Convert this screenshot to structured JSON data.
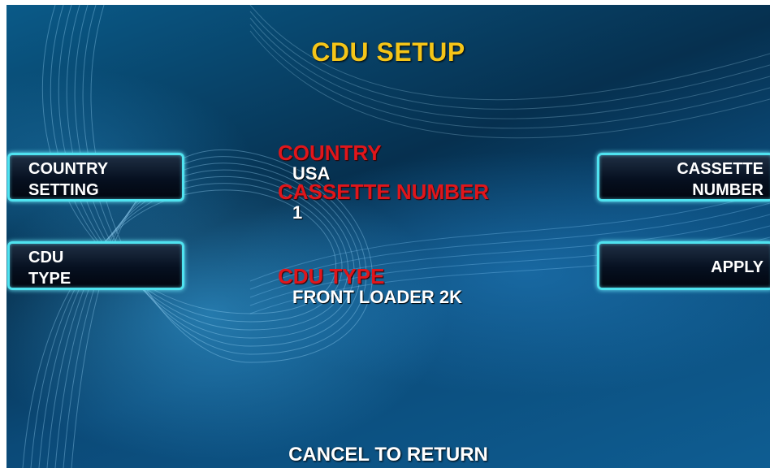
{
  "screen": {
    "title": "CDU SETUP",
    "footer": "CANCEL TO RETURN"
  },
  "left_buttons": [
    {
      "line1": "COUNTRY",
      "line2": "SETTING"
    },
    {
      "line1": "CDU",
      "line2": "TYPE"
    }
  ],
  "right_buttons": [
    {
      "line1": "CASSETTE",
      "line2": "NUMBER"
    },
    {
      "line1": "APPLY",
      "line2": ""
    }
  ],
  "info": {
    "country_label": "COUNTRY",
    "country_value": "USA",
    "cassette_label": "CASSETTE NUMBER",
    "cassette_value": "1",
    "cdu_type_label": "CDU TYPE",
    "cdu_type_value": "FRONT LOADER 2K"
  },
  "colors": {
    "title": "#f5c518",
    "label": "#e0161b",
    "button_border": "#4fe3f0"
  }
}
